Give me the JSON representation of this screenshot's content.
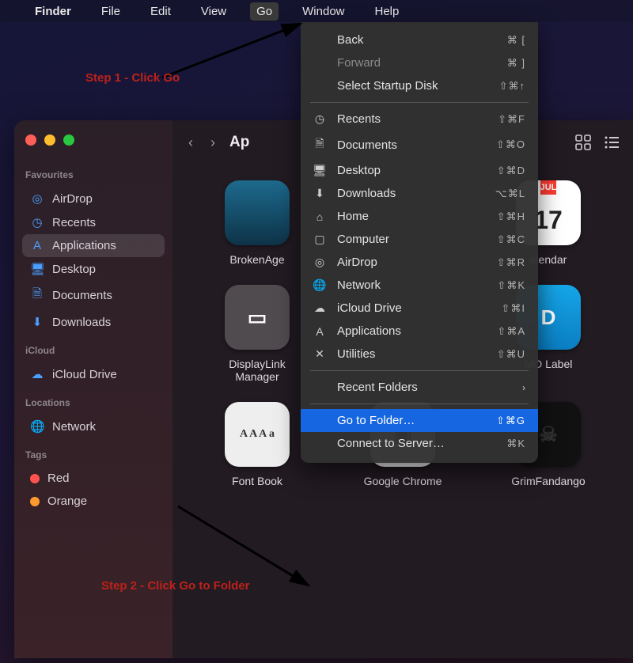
{
  "menubar": {
    "apple": "",
    "app": "Finder",
    "items": [
      "File",
      "Edit",
      "View",
      "Go",
      "Window",
      "Help"
    ],
    "open": "Go"
  },
  "annotations": {
    "step1": "Step 1 - Click Go",
    "step2": "Step 2 - Click Go to Folder"
  },
  "dropdown": {
    "groups": [
      [
        {
          "label": "Back",
          "shortcut": "⌘ [",
          "disabled": false
        },
        {
          "label": "Forward",
          "shortcut": "⌘ ]",
          "disabled": true
        },
        {
          "label": "Select Startup Disk",
          "shortcut": "⇧⌘↑",
          "disabled": false
        }
      ],
      [
        {
          "icon": "clock",
          "label": "Recents",
          "shortcut": "⇧⌘F"
        },
        {
          "icon": "doc",
          "label": "Documents",
          "shortcut": "⇧⌘O"
        },
        {
          "icon": "desktop",
          "label": "Desktop",
          "shortcut": "⇧⌘D"
        },
        {
          "icon": "download",
          "label": "Downloads",
          "shortcut": "⌥⌘L"
        },
        {
          "icon": "home",
          "label": "Home",
          "shortcut": "⇧⌘H"
        },
        {
          "icon": "computer",
          "label": "Computer",
          "shortcut": "⇧⌘C"
        },
        {
          "icon": "airdrop",
          "label": "AirDrop",
          "shortcut": "⇧⌘R"
        },
        {
          "icon": "network",
          "label": "Network",
          "shortcut": "⇧⌘K"
        },
        {
          "icon": "icloud",
          "label": "iCloud Drive",
          "shortcut": "⇧⌘I"
        },
        {
          "icon": "apps",
          "label": "Applications",
          "shortcut": "⇧⌘A"
        },
        {
          "icon": "utilities",
          "label": "Utilities",
          "shortcut": "⇧⌘U"
        }
      ],
      [
        {
          "label": "Recent Folders",
          "submenu": true
        }
      ],
      [
        {
          "label": "Go to Folder…",
          "shortcut": "⇧⌘G",
          "highlight": true
        },
        {
          "label": "Connect to Server…",
          "shortcut": "⌘K"
        }
      ]
    ]
  },
  "window": {
    "title": "Ap",
    "sidebar": {
      "favourites_label": "Favourites",
      "favourites": [
        {
          "icon": "airdrop",
          "label": "AirDrop"
        },
        {
          "icon": "clock",
          "label": "Recents"
        },
        {
          "icon": "apps",
          "label": "Applications",
          "selected": true
        },
        {
          "icon": "desktop",
          "label": "Desktop"
        },
        {
          "icon": "doc",
          "label": "Documents"
        },
        {
          "icon": "download",
          "label": "Downloads"
        }
      ],
      "icloud_label": "iCloud",
      "icloud": [
        {
          "icon": "icloud",
          "label": "iCloud Drive"
        }
      ],
      "locations_label": "Locations",
      "locations": [
        {
          "icon": "network",
          "label": "Network"
        }
      ],
      "tags_label": "Tags",
      "tags": [
        {
          "color": "#ff5350",
          "label": "Red"
        },
        {
          "color": "#ff9a2e",
          "label": "Orange"
        }
      ]
    },
    "apps": [
      {
        "name": "BrokenAge",
        "style": "ic-broken"
      },
      {
        "hidden": true,
        "name": ""
      },
      {
        "name": "alendar",
        "style": "ic-cal",
        "cal_month": "JUL",
        "cal_day": "17"
      },
      {
        "name": "DisplayLink\nManager",
        "style": "ic-dl",
        "glyph": "▭"
      },
      {
        "hidden": true,
        "name": ""
      },
      {
        "name": "MO Label",
        "style": "ic-dymo",
        "glyph": "D"
      },
      {
        "name": "Font Book",
        "style": "ic-font",
        "glyph": "A A\nA a"
      },
      {
        "name": "Google Chrome",
        "style": "ic-chrome",
        "glyph": "◉"
      },
      {
        "name": "GrimFandango",
        "style": "ic-grim",
        "glyph": "☠"
      }
    ]
  }
}
